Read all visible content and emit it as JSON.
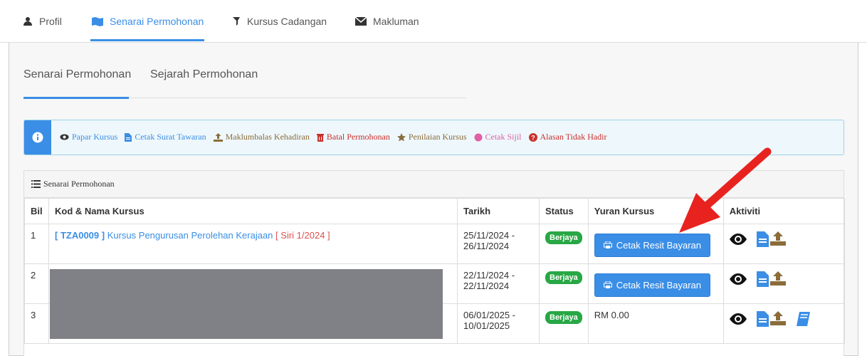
{
  "top_tabs": [
    {
      "label": "Profil",
      "icon": "user-icon",
      "active": false
    },
    {
      "label": "Senarai Permohonan",
      "icon": "map-icon",
      "active": true
    },
    {
      "label": "Kursus Cadangan",
      "icon": "pin-icon",
      "active": false
    },
    {
      "label": "Makluman",
      "icon": "envelope-icon",
      "active": false
    }
  ],
  "sub_tabs": [
    {
      "label": "Senarai Permohonan",
      "active": true
    },
    {
      "label": "Sejarah Permohonan",
      "active": false
    }
  ],
  "legend": {
    "items": [
      {
        "label": "Papar Kursus",
        "color": "#3a8ee6",
        "icon": "eye-icon"
      },
      {
        "label": "Cetak Surat Tawaran",
        "color": "#3a8ee6",
        "icon": "document-icon"
      },
      {
        "label": "Maklumbalas Kehadiran",
        "color": "#8a6d3b",
        "icon": "upload-icon"
      },
      {
        "label": "Batal Permohonan",
        "color": "#c9302c",
        "icon": "trash-icon"
      },
      {
        "label": "Penilaian Kursus",
        "color": "#8a6d3b",
        "icon": "star-icon"
      },
      {
        "label": "Cetak Sijil",
        "color": "#e05fa6",
        "icon": "certificate-icon"
      },
      {
        "label": "Alasan Tidak Hadir",
        "color": "#c9302c",
        "icon": "question-icon"
      }
    ]
  },
  "list": {
    "title": "Senarai Permohonan",
    "columns": [
      "Bil",
      "Kod & Nama Kursus",
      "Tarikh",
      "Status",
      "Yuran Kursus",
      "Aktiviti"
    ],
    "rows": [
      {
        "bil": "1",
        "kod": "[ TZA0009 ]",
        "nama": "Kursus Pengurusan Perolehan Kerajaan",
        "siri": "[ Siri 1/2024 ]",
        "tarikh_mula": "25/11/2024 -",
        "tarikh_tamat": "26/11/2024",
        "status": "Berjaya",
        "yuran_button": "Cetak Resit Bayaran"
      },
      {
        "bil": "2",
        "tarikh_mula": "22/11/2024 -",
        "tarikh_tamat": "22/11/2024",
        "status": "Berjaya",
        "yuran_button": "Cetak Resit Bayaran"
      },
      {
        "bil": "3",
        "tarikh_mula": "06/01/2025 -",
        "tarikh_tamat": "10/01/2025",
        "status": "Berjaya",
        "yuran": "RM 0.00"
      }
    ]
  },
  "colors": {
    "accent": "#3a8ee6",
    "success": "#28a745",
    "danger": "#c9302c",
    "annotation_arrow": "#e8231f"
  }
}
